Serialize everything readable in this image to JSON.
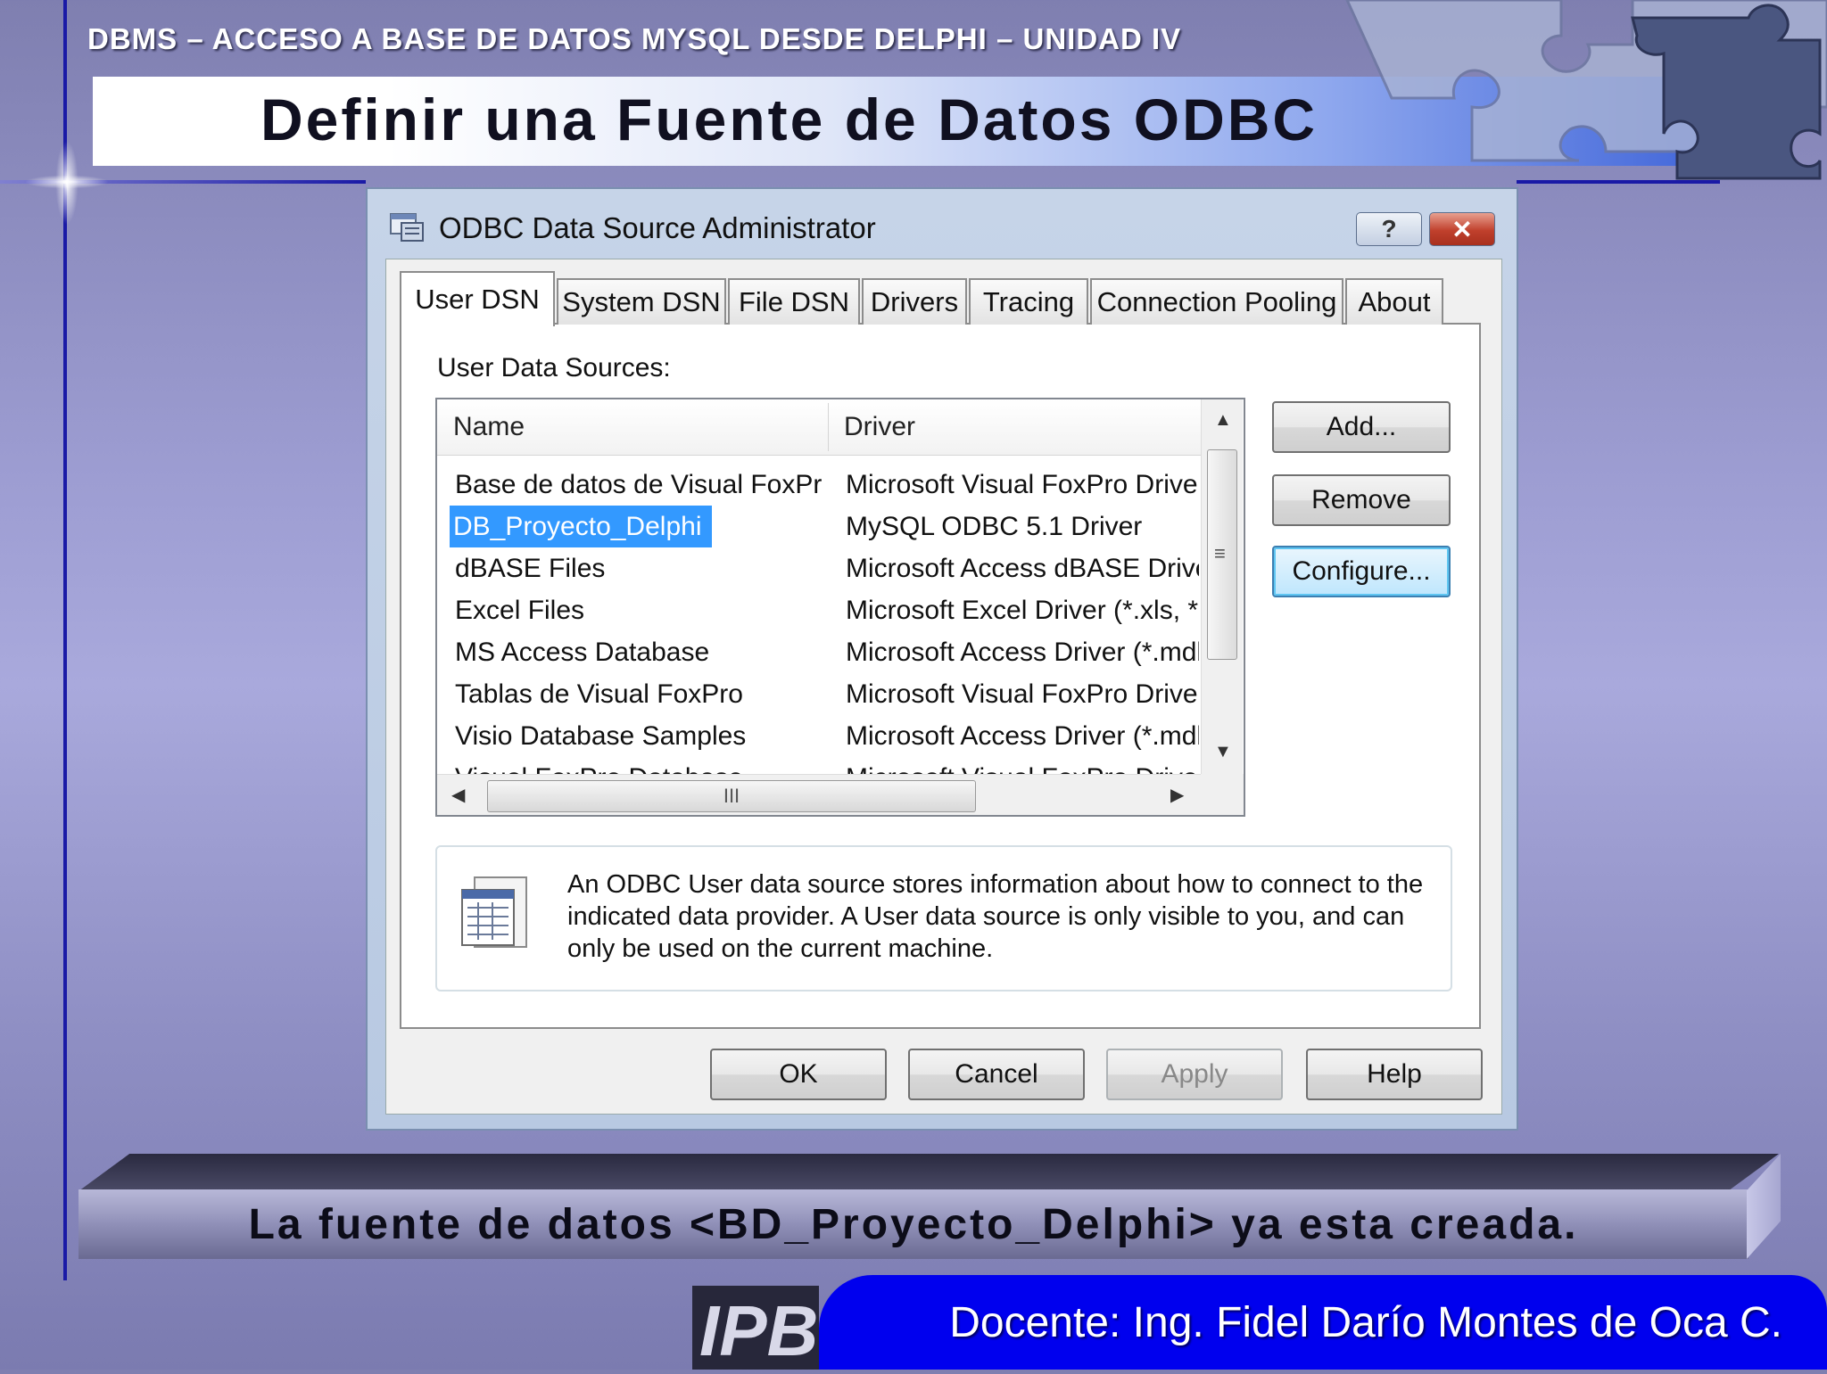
{
  "slide": {
    "course_line": "DBMS – ACCESO A BASE DE DATOS MYSQL DESDE DELPHI – UNIDAD IV",
    "title": "Definir una Fuente de Datos ODBC",
    "caption": "La fuente de datos <BD_Proyecto_Delphi> ya esta creada.",
    "docente": "Docente: Ing. Fidel Darío Montes de Oca C.",
    "logo_text": "IPB"
  },
  "dialog": {
    "title": "ODBC Data Source Administrator",
    "help_glyph": "?",
    "close_glyph": "✕",
    "tabs": [
      {
        "label": "User DSN",
        "active": true
      },
      {
        "label": "System DSN"
      },
      {
        "label": "File DSN"
      },
      {
        "label": "Drivers"
      },
      {
        "label": "Tracing"
      },
      {
        "label": "Connection Pooling"
      },
      {
        "label": "About"
      }
    ],
    "sources_label": "User Data Sources:",
    "columns": {
      "name": "Name",
      "driver": "Driver"
    },
    "rows": [
      {
        "name": "Base de datos de Visual FoxPro",
        "driver": "Microsoft Visual FoxPro Driver"
      },
      {
        "name": "DB_Proyecto_Delphi",
        "driver": "MySQL ODBC 5.1 Driver",
        "selected": true
      },
      {
        "name": "dBASE Files",
        "driver": "Microsoft Access dBASE Drive"
      },
      {
        "name": "Excel Files",
        "driver": "Microsoft Excel Driver (*.xls, *.x"
      },
      {
        "name": "MS Access Database",
        "driver": "Microsoft Access Driver (*.mdb"
      },
      {
        "name": "Tablas de Visual FoxPro",
        "driver": "Microsoft Visual FoxPro Driver"
      },
      {
        "name": "Visio Database Samples",
        "driver": "Microsoft Access Driver (*.mdb"
      },
      {
        "name": "Visual FoxPro Database",
        "driver": "Microsoft Visual FoxPro Driver"
      }
    ],
    "side_buttons": {
      "add": "Add...",
      "remove": "Remove",
      "configure": "Configure..."
    },
    "info_text": "An ODBC User data source stores information about how to connect to the indicated data provider.   A User data source is only visible to you, and can only be used on the current machine.",
    "bottom_buttons": {
      "ok": "OK",
      "cancel": "Cancel",
      "apply": "Apply",
      "help": "Help"
    },
    "hscroll_grip": "III"
  }
}
